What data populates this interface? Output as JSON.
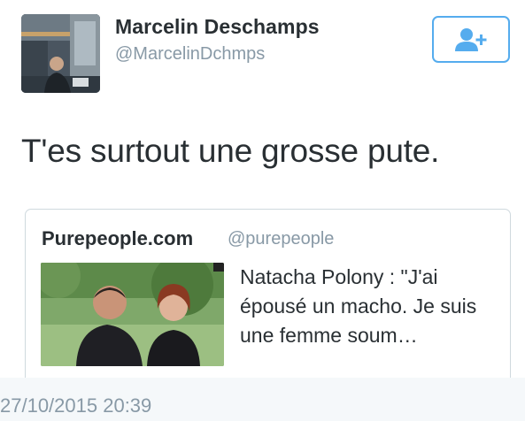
{
  "tweet": {
    "display_name": "Marcelin Deschamps",
    "handle": "@MarcelinDchmps",
    "text": "T'es surtout une grosse pute.",
    "timestamp": "27/10/2015 20:39",
    "avatar_icon": "user-photo",
    "follow_button_icon": "add-user-icon"
  },
  "quoted": {
    "name": "Purepeople.com",
    "handle": "@purepeople",
    "title": "Natacha Polony : \"J'ai épousé un macho. Je suis une femme soum…",
    "thumbnail": "photo-of-couple"
  },
  "colors": {
    "accent": "#55acee",
    "text": "#292f33",
    "muted": "#8899a6",
    "border": "#cfd9de"
  }
}
